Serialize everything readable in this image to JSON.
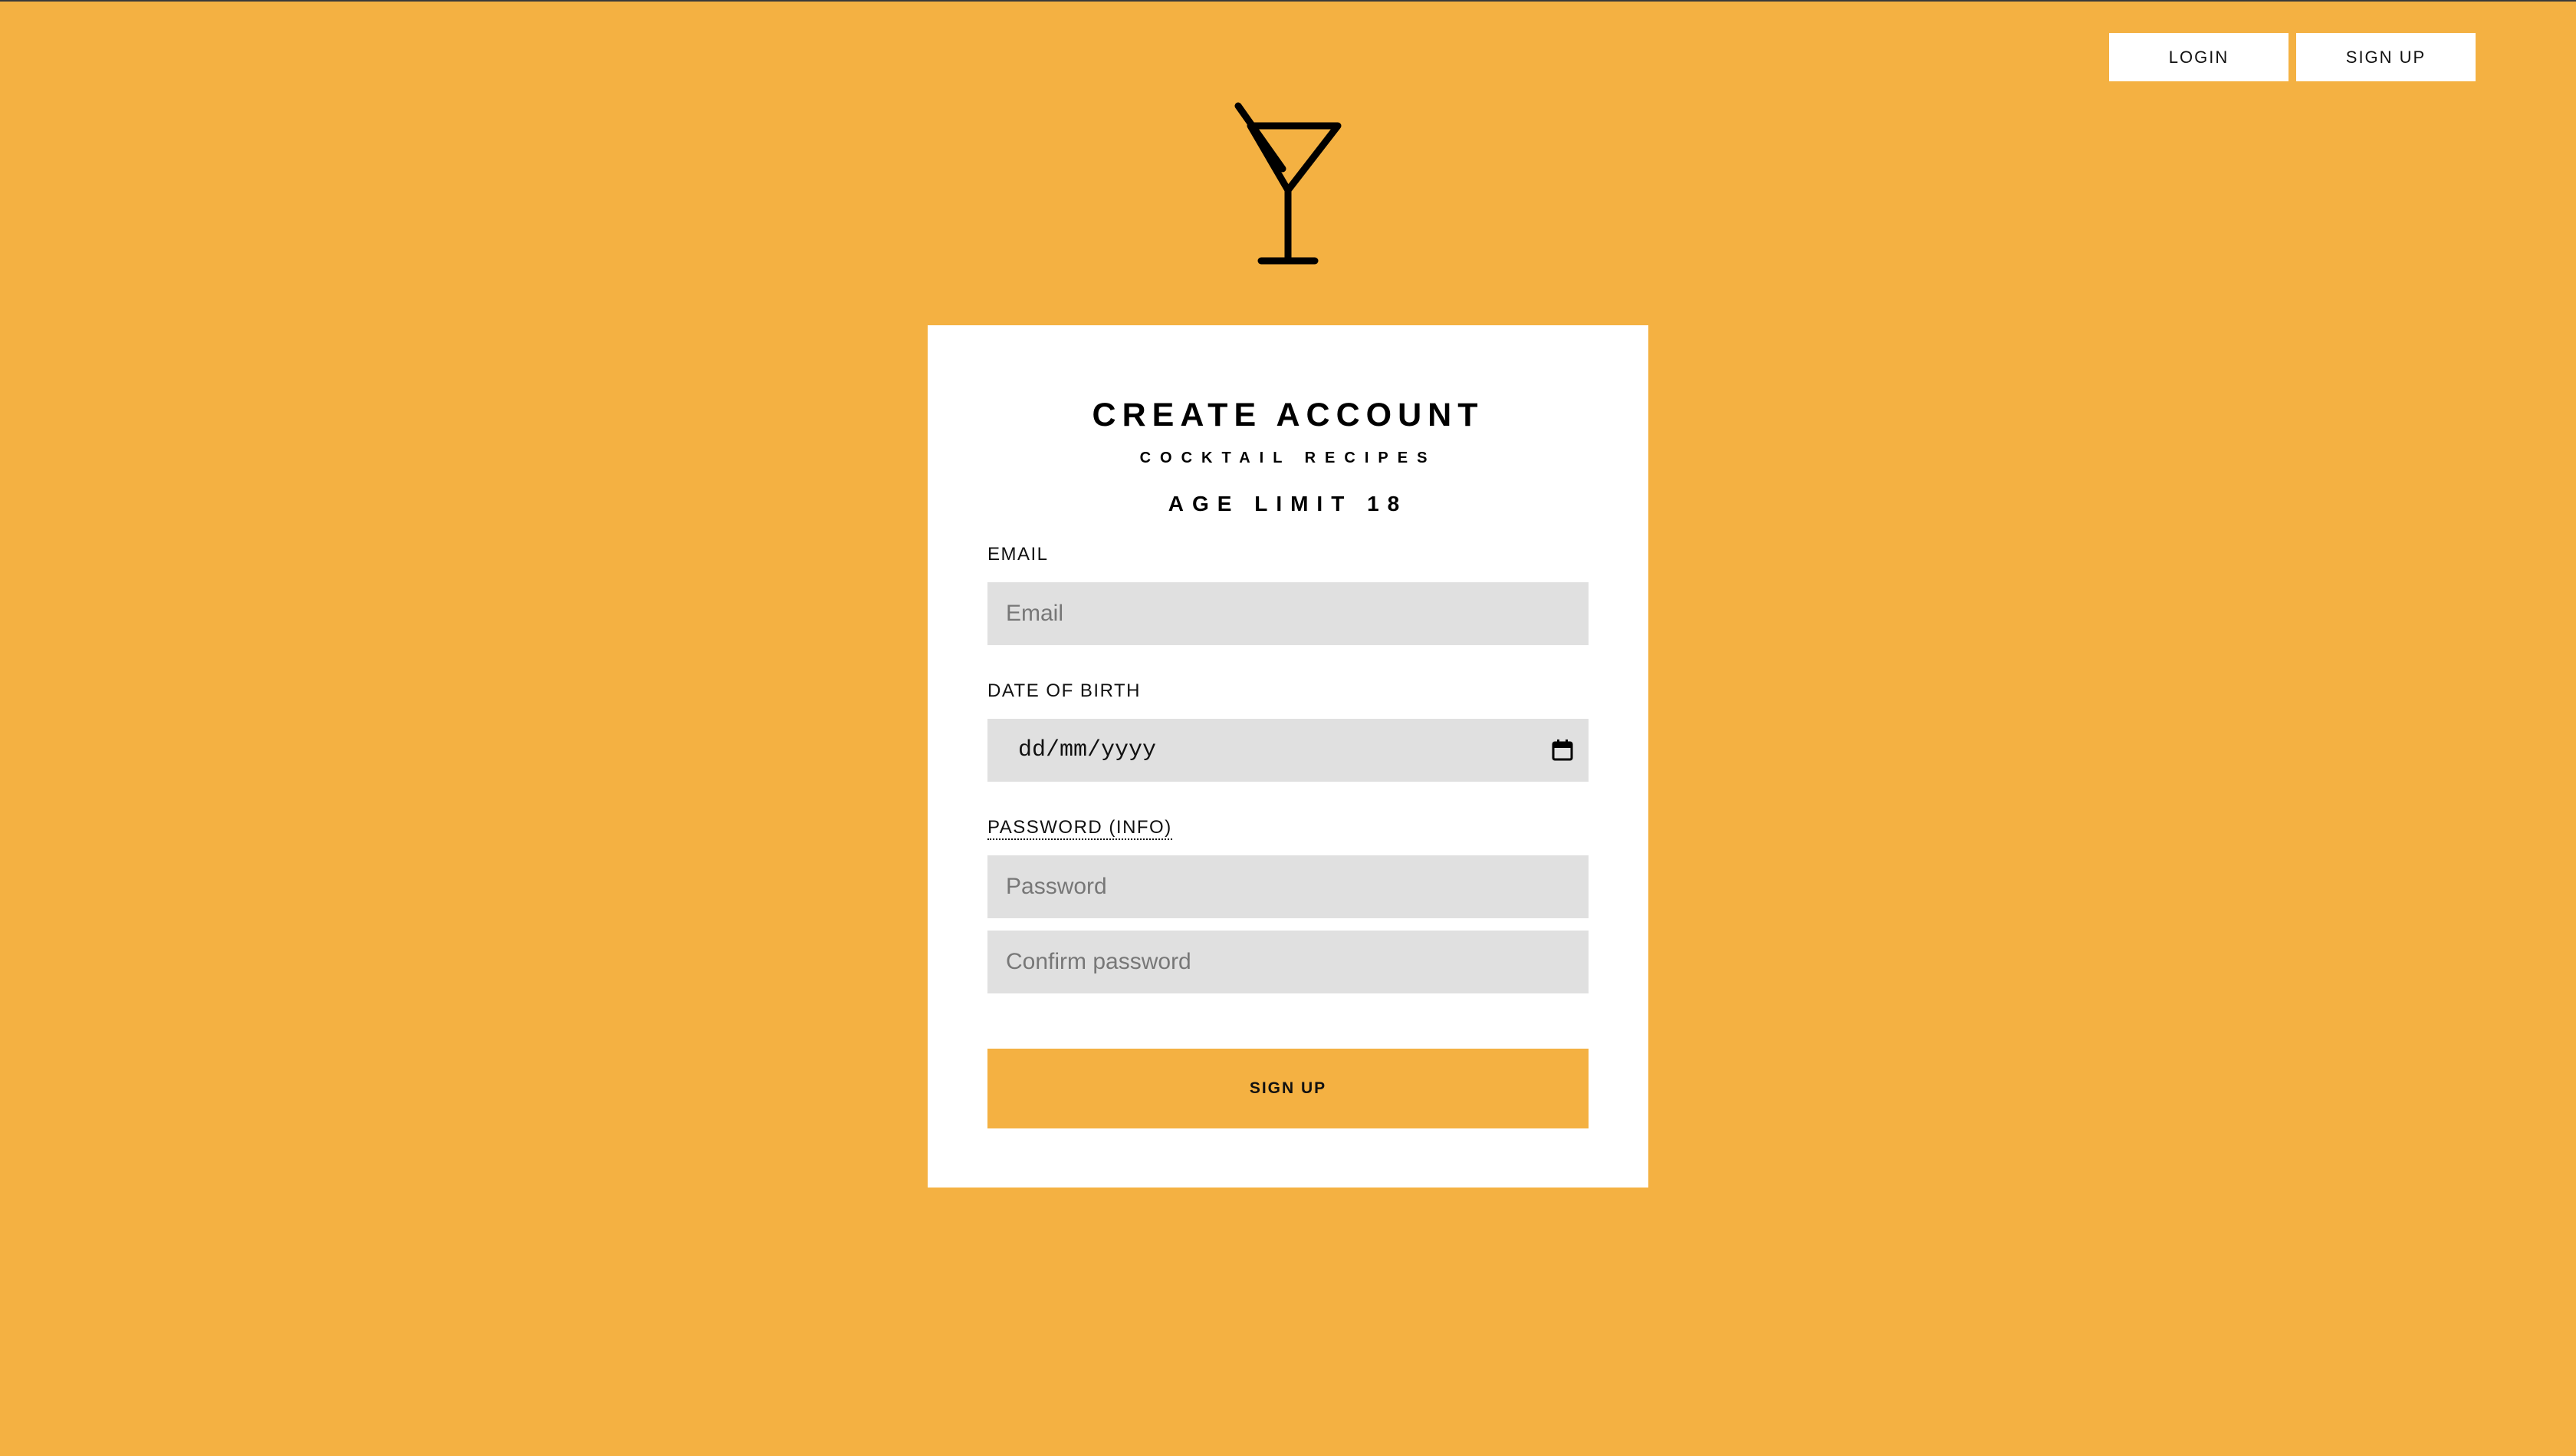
{
  "nav": {
    "login_label": "LOGIN",
    "signup_label": "SIGN UP"
  },
  "logo": {
    "icon": "cocktail-glass-icon"
  },
  "form": {
    "title": "CREATE ACCOUNT",
    "subtitle": "COCKTAIL RECIPES",
    "age_limit": "AGE LIMIT 18",
    "email": {
      "label": "EMAIL",
      "placeholder": "Email",
      "value": ""
    },
    "dob": {
      "label": "DATE OF BIRTH",
      "placeholder": "dd/mm/yyyy",
      "icon": "calendar-icon"
    },
    "password": {
      "label": "PASSWORD (INFO)",
      "placeholder": "Password",
      "confirm_placeholder": "Confirm password"
    },
    "submit_label": "SIGN UP"
  },
  "colors": {
    "background": "#F4B142",
    "card": "#FFFFFF",
    "input": "#E0E0E0",
    "text": "#000000"
  }
}
